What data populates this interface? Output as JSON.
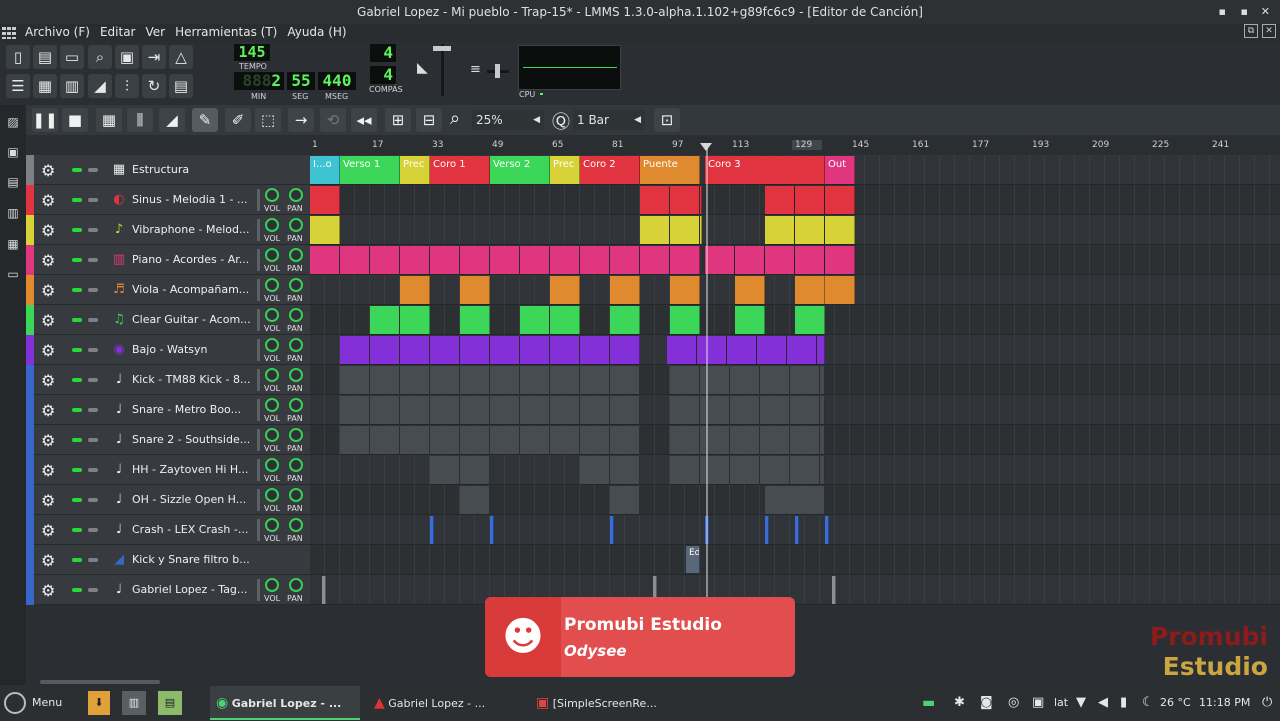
{
  "window": {
    "title": "Gabriel Lopez - Mi pueblo - Trap-15* - LMMS 1.3.0-alpha.1.102+g89fc6c9 - [Editor de Canción]"
  },
  "menu": [
    "Archivo (F)",
    "Editar",
    "Ver",
    "Herramientas (T)",
    "Ayuda (H)"
  ],
  "transport": {
    "tempo": "145",
    "tempo_label": "TEMPO",
    "time_min": "2",
    "time_min_ghost": "888",
    "time_sec": "55",
    "time_msec": "440",
    "label_min": "MIN",
    "label_sec": "SEG",
    "label_msec": "MSEG",
    "ts_num": "4",
    "ts_den": "4",
    "ts_label": "COMPÁS",
    "cpu_label": "CPU"
  },
  "song_toolbar": {
    "zoom": "25%",
    "quantize": "1 Bar"
  },
  "ruler": [
    "1",
    "17",
    "33",
    "49",
    "65",
    "81",
    "97",
    "113",
    "129",
    "145",
    "161",
    "177",
    "193",
    "209",
    "225",
    "241"
  ],
  "tracks": [
    {
      "name": "Estructura",
      "color": "#7d8085",
      "icon": "pattern-icon"
    },
    {
      "name": "Sinus - Melodia 1 - ...",
      "color": "#e23340",
      "icon": "sinus-icon"
    },
    {
      "name": "Vibraphone - Melod...",
      "color": "#d7d237",
      "icon": "vibraphone-icon"
    },
    {
      "name": "Piano - Acordes - Ar...",
      "color": "#e0367f",
      "icon": "piano-icon"
    },
    {
      "name": "Viola - Acompañam...",
      "color": "#e08a2f",
      "icon": "viola-icon"
    },
    {
      "name": "Clear Guitar - Acom...",
      "color": "#3cd758",
      "icon": "guitar-icon"
    },
    {
      "name": "Bajo - Watsyn",
      "color": "#8330d8",
      "icon": "watsyn-icon"
    },
    {
      "name": "Kick - TM88 Kick - 8...",
      "color": "#3667c9",
      "icon": "note-icon"
    },
    {
      "name": "Snare - Metro Boo...",
      "color": "#3667c9",
      "icon": "note-icon"
    },
    {
      "name": "Snare 2 - Southside...",
      "color": "#3667c9",
      "icon": "note-icon"
    },
    {
      "name": "HH - Zaytoven Hi H...",
      "color": "#3667c9",
      "icon": "note-icon"
    },
    {
      "name": "OH - Sizzle Open H...",
      "color": "#3667c9",
      "icon": "note-icon"
    },
    {
      "name": "Crash - LEX Crash -...",
      "color": "#3667c9",
      "icon": "note-icon"
    },
    {
      "name": "Kick y Snare filtro b...",
      "color": "#3667c9",
      "icon": "automation-icon"
    },
    {
      "name": "Gabriel Lopez - Tag...",
      "color": "#3667c9",
      "icon": "note-icon"
    }
  ],
  "knob_labels": {
    "vol": "VOL",
    "pan": "PAN"
  },
  "structure_labels": [
    "I...o",
    "Verso 1",
    "Prec",
    "Coro 1",
    "Verso 2",
    "Prec",
    "Coro 2",
    "Puente",
    "Coro 3",
    "Out"
  ],
  "automation_clip_label": "Ed",
  "promo": {
    "line1": "Promubi Estudio",
    "line2": "Odysee"
  },
  "watermark": {
    "line1": "Promubi",
    "line2": "Estudio"
  },
  "taskbar": {
    "menu": "Menu",
    "tasks": [
      "Gabriel Lopez - ...",
      "Gabriel Lopez - ...",
      "[SimpleScreenRe..."
    ],
    "lang": "lat",
    "temp": "26 °C",
    "clock": "11:18 PM"
  }
}
